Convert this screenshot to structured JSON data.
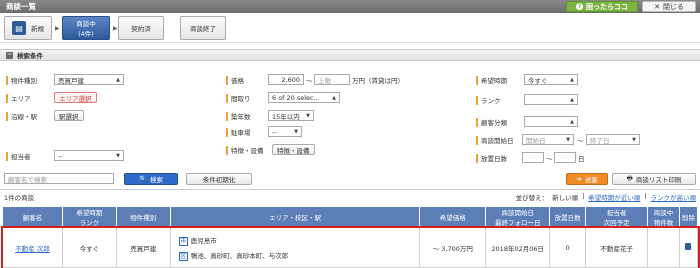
{
  "window": {
    "title": "商談一覧",
    "help_label": "困ったらココ",
    "close_label": "閉じる"
  },
  "steps": {
    "new": "新規",
    "active_line1": "商談中",
    "active_line2": "(4件)",
    "contract": "契約済",
    "finished": "商談終了"
  },
  "section_title": "検索条件",
  "form": {
    "property_type_label": "物件種別",
    "property_type_value": "売買戸建",
    "area_label": "エリア",
    "area_button": "エリア選択",
    "line_label": "沿線・駅",
    "station_button": "駅選択",
    "staff_label": "担当者",
    "staff_value": "--",
    "price_label": "価格",
    "price_min": "2,600",
    "price_tilde": "〜",
    "price_max_placeholder": "上限",
    "price_unit": "万円（賃貸は円）",
    "layout_label": "間取り",
    "layout_value": "6 of 20 selec...",
    "age_label": "築年数",
    "age_value": "15年以内",
    "parking_label": "駐車場",
    "parking_value": "--",
    "features_label": "特徴・設備",
    "features_button": "特徴・設備",
    "timing_label": "希望時期",
    "timing_value": "今すぐ",
    "rank_label": "ランク",
    "customer_cat_label": "顧客分類",
    "start_date_label": "商談開始日",
    "start_placeholder": "開始日",
    "end_placeholder": "終了日",
    "date_tilde": "〜",
    "days_label": "放置日数",
    "days_tilde": "〜",
    "days_unit": "日"
  },
  "search": {
    "customer_placeholder": "顧客名で検索",
    "search_button": "検索",
    "reset_button": "条件初期化",
    "send_button": "送客",
    "print_button": "商談リスト印刷"
  },
  "results": {
    "count": "1件の商談",
    "sort_label": "並び替え：",
    "sort_new": "新しい順",
    "sort_near": "希望時期が近い順",
    "sort_high": "ランクが高い順",
    "sep": "|"
  },
  "table": {
    "headers": {
      "customer": "顧客名",
      "timing_top": "希望時期",
      "timing_bottom": "ランク",
      "type": "物件種別",
      "area": "エリア・校区・駅",
      "price": "希望価格",
      "start_top": "商談開始日",
      "start_bottom": "最終フォロー日",
      "days": "放置日数",
      "staff_top": "担当者",
      "staff_bottom": "次回予定",
      "count_top": "商談中",
      "count_bottom": "物件数",
      "delete": "削除"
    },
    "row": {
      "customer": "不動産 次郎",
      "timing": "今すぐ",
      "type": "売買戸建",
      "area_tag1": "市",
      "area_line1": "鹿児島市",
      "area_tag2": "区",
      "area_line2": "鴨池、真砂町、真砂本町、与次郎",
      "price": "～ 3,700万円",
      "start_date": "2018年02月06日",
      "days": "0",
      "staff": "不動産花子"
    }
  }
}
